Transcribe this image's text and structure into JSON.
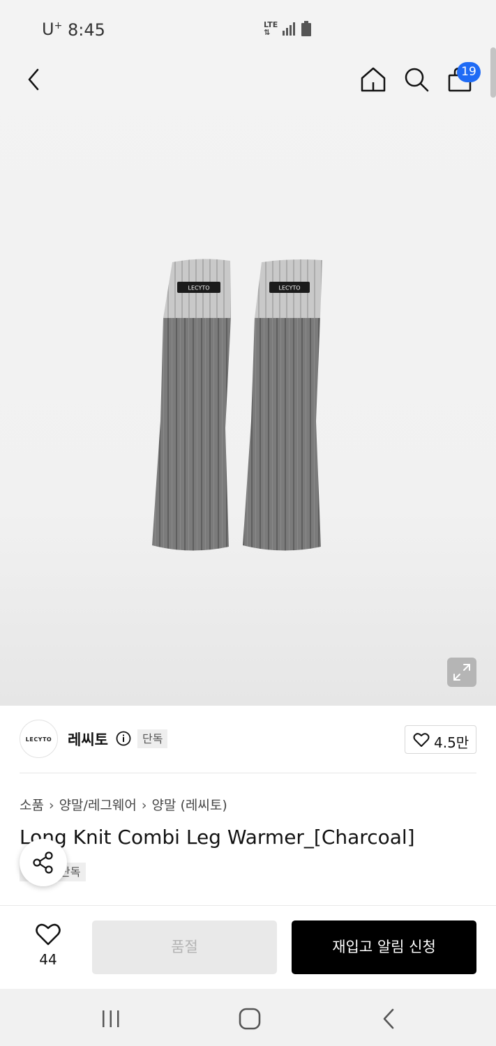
{
  "status_bar": {
    "carrier": "U",
    "carrier_sup": "+",
    "time": "8:45",
    "network": "LTE"
  },
  "header": {
    "cart_count": "19"
  },
  "product_image": {
    "brand_label_left": "LECYTO",
    "brand_label_right": "LECYTO"
  },
  "brand": {
    "logo_text": "LECYTO",
    "name": "레씨토",
    "exclusive_tag": "단독",
    "like_count": "4.5만"
  },
  "breadcrumb": [
    "소품",
    "양말/레그웨어",
    "양말 (레씨토)"
  ],
  "product": {
    "title": "Long Knit Combi Leg Warmer_[Charcoal]",
    "tag": "단독"
  },
  "actions": {
    "wish_count": "44",
    "soldout_label": "품절",
    "restock_label": "재입고 알림 신청"
  },
  "colors": {
    "accent": "#1f6bf5",
    "primary_button": "#000000",
    "disabled_button": "#e9e9e9"
  },
  "icons": [
    "back-icon",
    "home-icon",
    "search-icon",
    "cart-icon",
    "expand-icon",
    "info-icon",
    "heart-icon",
    "share-icon",
    "recent-apps-icon",
    "system-home-icon",
    "system-back-icon"
  ]
}
